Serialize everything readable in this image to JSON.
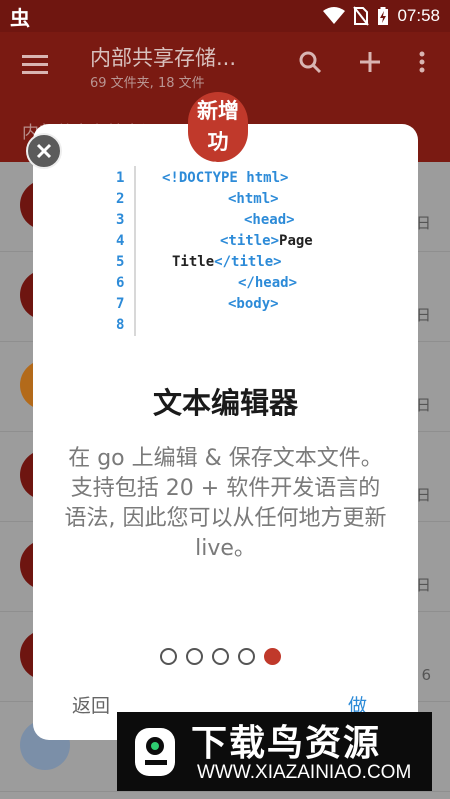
{
  "status_bar": {
    "time": "07:58",
    "icons": [
      "app-glyph",
      "wifi-icon",
      "no-sim-icon",
      "battery-charging-icon"
    ]
  },
  "toolbar": {
    "title": "内部共享存储...",
    "subtitle": "69 文件夹, 18 文件",
    "icons": [
      "menu-icon",
      "search-icon",
      "add-icon",
      "more-icon"
    ]
  },
  "path_bar": {
    "text": "内部共享存储空间"
  },
  "list": {
    "peek_dates": [
      "日",
      "日",
      "日",
      "日",
      "日",
      "6"
    ]
  },
  "dialog": {
    "badge": "新增功\n能!",
    "code_lines": {
      "numbers": [
        "1",
        "2",
        "3",
        "4",
        "5",
        "6",
        "7",
        "8"
      ]
    },
    "title": "文本编辑器",
    "description": "在 go 上编辑 & 保存文本文件。支持包括 20 + 软件开发语言的语法, 因此您可以从任何地方更新 live。",
    "pages": 5,
    "active_page": 5,
    "back_label": "返回",
    "done_label": "做"
  },
  "watermark": {
    "title": "下载鸟资源",
    "url": "WWW.XIAZAINIAO.COM"
  },
  "colors": {
    "accent": "#c0392b",
    "toolbar_dimmed": "#7a1a12",
    "link_blue": "#2d8bd8"
  }
}
